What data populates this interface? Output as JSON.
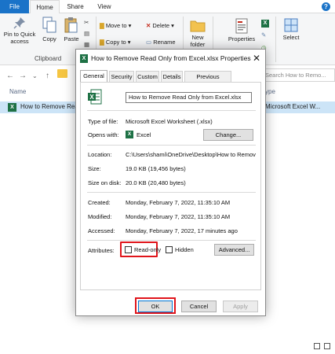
{
  "ribbon_tabs": [
    "File",
    "Home",
    "Share",
    "View"
  ],
  "ribbon": {
    "pin_label": "Pin to Quick access",
    "copy_label": "Copy",
    "paste_label": "Paste",
    "move_to": "Move to ▾",
    "copy_to": "Copy to ▾",
    "delete": "Delete ▾",
    "rename": "Rename",
    "new_folder": "New folder",
    "properties": "Properties",
    "select": "Select",
    "clipboard_group": "Clipboard",
    "open_group": "Open"
  },
  "address": {
    "search_placeholder": "Search How to Remo..."
  },
  "list": {
    "name_header": "Name",
    "type_header": "ype",
    "file_name": "How to Remove Rea",
    "file_type": "Microsoft Excel W..."
  },
  "dialog": {
    "title": "How to Remove Read Only from Excel.xlsx Properties",
    "close": "✕",
    "tabs": [
      "General",
      "Security",
      "Custom",
      "Details",
      "Previous Versions"
    ],
    "file_name": "How to Remove Read Only from Excel.xlsx",
    "type_label": "Type of file:",
    "type_value": "Microsoft Excel Worksheet (.xlsx)",
    "opens_label": "Opens with:",
    "opens_value": "Excel",
    "change_button": "Change...",
    "location_label": "Location:",
    "location_value": "C:\\Users\\shami\\OneDrive\\Desktop\\How to Remov",
    "size_label": "Size:",
    "size_value": "19.0 KB (19,456 bytes)",
    "size_disk_label": "Size on disk:",
    "size_disk_value": "20.0 KB (20,480 bytes)",
    "created_label": "Created:",
    "created_value": "Monday, February 7, 2022, 11:35:10 AM",
    "modified_label": "Modified:",
    "modified_value": "Monday, February 7, 2022, 11:35:10 AM",
    "accessed_label": "Accessed:",
    "accessed_value": "Monday, February 7, 2022, 17 minutes ago",
    "attributes_label": "Attributes:",
    "readonly_label": "Read-only",
    "hidden_label": "Hidden",
    "advanced_button": "Advanced...",
    "ok_button": "OK",
    "cancel_button": "Cancel",
    "apply_button": "Apply"
  },
  "colors": {
    "highlight": "#e0151b",
    "excel_green": "#1e7145",
    "file_tab_blue": "#1a73c8",
    "selection": "#cce4f7"
  }
}
